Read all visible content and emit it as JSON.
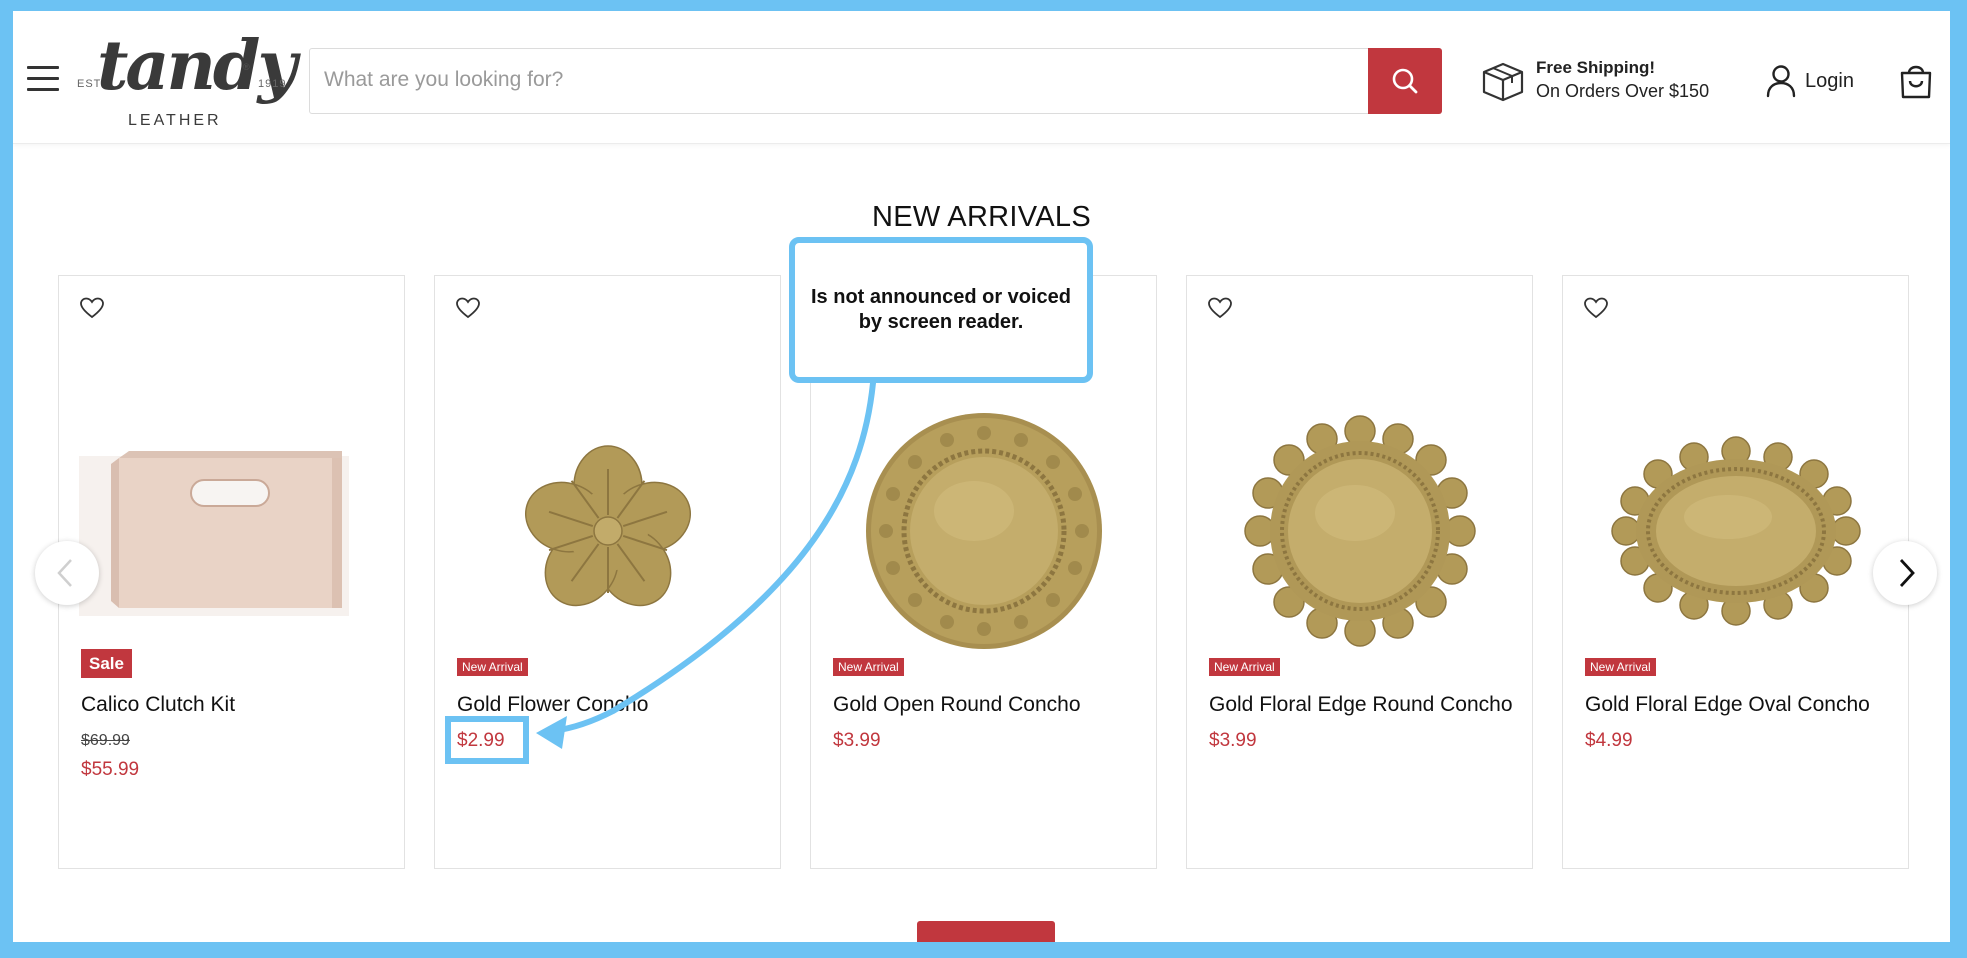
{
  "header": {
    "logo": {
      "est": "EST",
      "year": "1919",
      "name": "tandy",
      "registered": "®",
      "sub": "LEATHER"
    },
    "search": {
      "placeholder": "What are you looking for?"
    },
    "shipping": {
      "title": "Free Shipping!",
      "subtitle": "On Orders Over $150"
    },
    "login_label": "Login"
  },
  "section": {
    "title": "NEW ARRIVALS"
  },
  "products": [
    {
      "name": "Calico Clutch Kit",
      "badge": "Sale",
      "compare_price": "$69.99",
      "price": "$55.99"
    },
    {
      "name": "Gold Flower Concho",
      "badge": "New Arrival",
      "price": "$2.99"
    },
    {
      "name": "Gold Open Round Concho",
      "badge": "New Arrival",
      "price": "$3.99"
    },
    {
      "name": "Gold Floral Edge Round Concho",
      "badge": "New Arrival",
      "price": "$3.99"
    },
    {
      "name": "Gold Floral Edge Oval Concho",
      "badge": "New Arrival",
      "price": "$4.99"
    }
  ],
  "annotation": {
    "text": "Is not announced or voiced by screen reader."
  },
  "icons": [
    "hamburger-icon",
    "search-icon",
    "box-icon",
    "user-icon",
    "bag-icon",
    "heart-icon",
    "chevron-left-icon",
    "chevron-right-icon"
  ],
  "colors": {
    "brand_red": "#c1373e",
    "annotation_blue": "#6cc2f3",
    "gold": "#b29a58"
  }
}
